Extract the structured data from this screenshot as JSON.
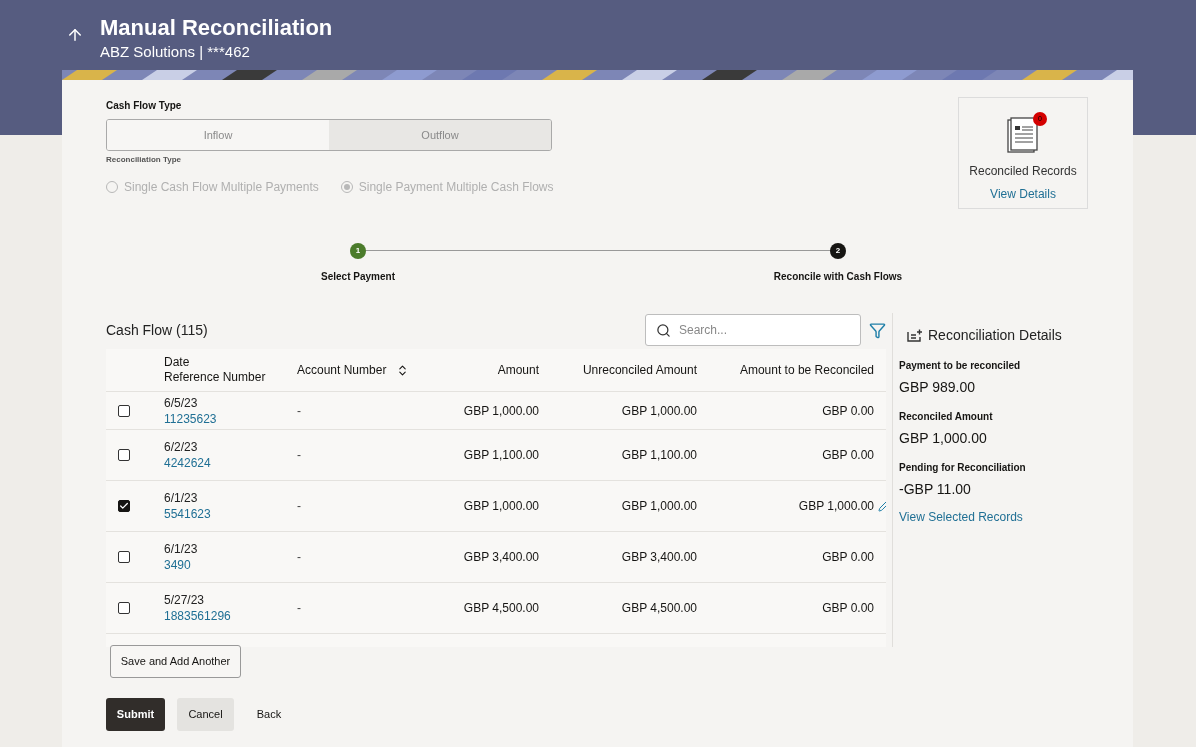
{
  "header": {
    "title": "Manual Reconciliation",
    "subtitle": "ABZ Solutions | ***462"
  },
  "cash_flow_type": {
    "label": "Cash Flow Type",
    "options": [
      {
        "label": "Inflow",
        "selected": false
      },
      {
        "label": "Outflow",
        "selected": true
      }
    ]
  },
  "reconciliation_type": {
    "label": "Reconciliation Type",
    "disabled": true,
    "options": [
      {
        "label": "Single Cash Flow Multiple Payments",
        "selected": false
      },
      {
        "label": "Single Payment Multiple Cash Flows",
        "selected": true
      }
    ]
  },
  "reconciled_records": {
    "badge": "0",
    "title": "Reconciled Records",
    "link": "View Details"
  },
  "steps": [
    {
      "number": "1",
      "label": "Select Payment",
      "completed": true
    },
    {
      "number": "2",
      "label": "Reconcile with Cash Flows",
      "completed": false
    }
  ],
  "table": {
    "title": "Cash Flow (115)",
    "search_placeholder": "Search...",
    "columns": [
      {
        "lines": [
          "Date",
          "Reference Number"
        ],
        "sortable": false
      },
      {
        "lines": [
          "Account Number"
        ],
        "sortable": true
      },
      {
        "lines": [
          "Amount"
        ],
        "sortable": false
      },
      {
        "lines": [
          "Unreconciled Amount"
        ],
        "sortable": false
      },
      {
        "lines": [
          "Amount to be Reconciled"
        ],
        "sortable": false
      }
    ],
    "rows": [
      {
        "checked": false,
        "date": "6/5/23",
        "reference": "11235623",
        "account": "-",
        "amount": "GBP 1,000.00",
        "unreconciled": "GBP 1,000.00",
        "to_reconcile": "GBP 0.00"
      },
      {
        "checked": false,
        "date": "6/2/23",
        "reference": "4242624",
        "account": "-",
        "amount": "GBP 1,100.00",
        "unreconciled": "GBP 1,100.00",
        "to_reconcile": "GBP 0.00"
      },
      {
        "checked": true,
        "date": "6/1/23",
        "reference": "5541623",
        "account": "-",
        "amount": "GBP 1,000.00",
        "unreconciled": "GBP 1,000.00",
        "to_reconcile": "GBP 1,000.00"
      },
      {
        "checked": false,
        "date": "6/1/23",
        "reference": "3490",
        "account": "-",
        "amount": "GBP 3,400.00",
        "unreconciled": "GBP 3,400.00",
        "to_reconcile": "GBP 0.00"
      },
      {
        "checked": false,
        "date": "5/27/23",
        "reference": "1883561296",
        "account": "-",
        "amount": "GBP 4,500.00",
        "unreconciled": "GBP 4,500.00",
        "to_reconcile": "GBP 0.00"
      }
    ]
  },
  "details": {
    "title": "Reconciliation Details",
    "items": [
      {
        "label": "Payment to be reconciled",
        "value": "GBP 989.00"
      },
      {
        "label": "Reconciled Amount",
        "value": "GBP 1,000.00"
      },
      {
        "label": "Pending for Reconciliation",
        "value": "-GBP 11.00"
      }
    ],
    "link": "View Selected Records"
  },
  "buttons": {
    "save_add": "Save and Add Another",
    "submit": "Submit",
    "cancel": "Cancel",
    "back": "Back"
  }
}
